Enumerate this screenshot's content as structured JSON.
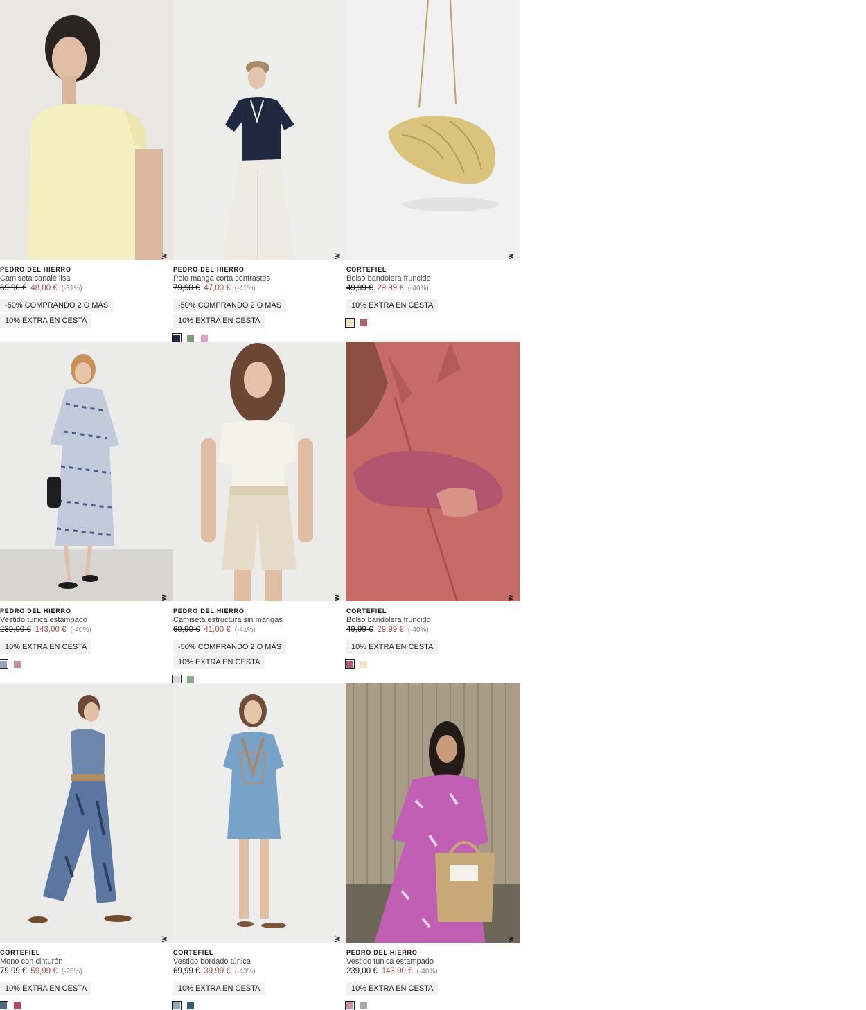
{
  "new_label": "NEW",
  "products": [
    {
      "brand": "PEDRO DEL HIERRO",
      "name": "Camiseta canalé lisa",
      "old_price": "69,90 €",
      "new_price": "48,00 €",
      "discount": "(-31%)",
      "promos": [
        "-50% COMPRANDO 2 O MÁS",
        "10% EXTRA EN CESTA"
      ],
      "swatches": []
    },
    {
      "brand": "PEDRO DEL HIERRO",
      "name": "Polo manga corta contrastes",
      "old_price": "79,90 €",
      "new_price": "47,00 €",
      "discount": "(-41%)",
      "promos": [
        "-50% COMPRANDO 2 O MÁS",
        "10% EXTRA EN CESTA"
      ],
      "swatches": [
        "#1d2a44",
        "#7c9a82",
        "#e39ec4"
      ]
    },
    {
      "brand": "CORTEFIEL",
      "name": "Bolso bandolera fruncido",
      "old_price": "49,99 €",
      "new_price": "29,99 €",
      "discount": "(-40%)",
      "promos": [
        "10% EXTRA EN CESTA"
      ],
      "swatches": [
        "#efe1c1",
        "#b0606a"
      ]
    },
    {
      "brand": "PEDRO DEL HIERRO",
      "name": "Vestido tunica estampado",
      "old_price": "239,00 €",
      "new_price": "143,00 €",
      "discount": "(-40%)",
      "promos": [
        "10% EXTRA EN CESTA"
      ],
      "swatches": [
        "#9aa6b8",
        "#c98aa6"
      ]
    },
    {
      "brand": "PEDRO DEL HIERRO",
      "name": "Camiseta estructura sin mangas",
      "old_price": "69,90 €",
      "new_price": "41,00 €",
      "discount": "(-41%)",
      "promos": [
        "-50% COMPRANDO 2 O MÁS",
        "10% EXTRA EN CESTA"
      ],
      "swatches": [
        "#d8d8d6",
        "#8fa88d"
      ]
    },
    {
      "brand": "CORTEFIEL",
      "name": "Bolso bandolera fruncido",
      "old_price": "49,99 €",
      "new_price": "29,99 €",
      "discount": "(-40%)",
      "promos": [
        "10% EXTRA EN CESTA"
      ],
      "swatches": [
        "#b0606a",
        "#f3e3c1"
      ]
    },
    {
      "brand": "CORTEFIEL",
      "name": "Mono con cinturón",
      "old_price": "79,99 €",
      "new_price": "59,99 €",
      "discount": "(-25%)",
      "promos": [
        "10% EXTRA EN CESTA"
      ],
      "swatches": [
        "#4b6a8a",
        "#b5485a"
      ]
    },
    {
      "brand": "CORTEFIEL",
      "name": "Vestido bordado túnica",
      "old_price": "69,99 €",
      "new_price": "39,99 €",
      "discount": "(-43%)",
      "promos": [
        "10% EXTRA EN CESTA"
      ],
      "swatches": [
        "#8aa9bd",
        "#2f5f78"
      ]
    },
    {
      "brand": "PEDRO DEL HIERRO",
      "name": "Vestido tunica estampado",
      "old_price": "239,00 €",
      "new_price": "143,00 €",
      "discount": "(-40%)",
      "promos": [
        "10% EXTRA EN CESTA"
      ],
      "swatches": [
        "#c78fa6",
        "#a9a9a9"
      ]
    }
  ]
}
